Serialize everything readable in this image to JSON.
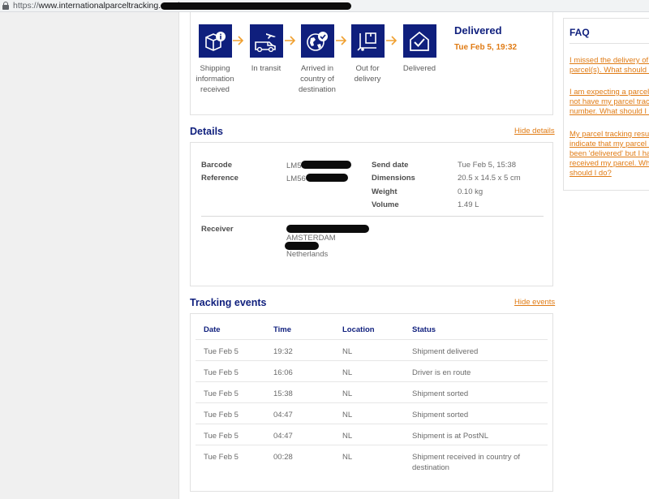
{
  "browser": {
    "url_scheme": "https://",
    "url_host": "www.internationalparceltracking.com/"
  },
  "status": {
    "steps": [
      {
        "label": "Shipping\ninformation\nreceived",
        "icon": "parcel-info-icon"
      },
      {
        "label": "In transit",
        "icon": "plane-van-icon"
      },
      {
        "label": "Arrived in\ncountry of\ndestination",
        "icon": "globe-check-icon"
      },
      {
        "label": "Out for\ndelivery",
        "icon": "box-dolly-icon"
      },
      {
        "label": "Delivered",
        "icon": "house-check-icon"
      }
    ],
    "title": "Delivered",
    "time": "Tue Feb 5, 19:32"
  },
  "details": {
    "title": "Details",
    "toggle": "Hide details",
    "barcode_label": "Barcode",
    "barcode_value": "LM5",
    "reference_label": "Reference",
    "reference_value": "LM56",
    "send_date_label": "Send date",
    "send_date_value": "Tue Feb 5, 15:38",
    "dimensions_label": "Dimensions",
    "dimensions_value": "20.5 x 14.5 x 5 cm",
    "weight_label": "Weight",
    "weight_value": "0.10 kg",
    "volume_label": "Volume",
    "volume_value": "1.49 L",
    "receiver_label": "Receiver",
    "receiver_city": "AMSTERDAM",
    "receiver_country": "Netherlands"
  },
  "events": {
    "title": "Tracking events",
    "toggle": "Hide events",
    "headers": {
      "date": "Date",
      "time": "Time",
      "location": "Location",
      "status": "Status"
    },
    "rows": [
      {
        "date": "Tue Feb 5",
        "time": "19:32",
        "location": "NL",
        "status": "Shipment delivered"
      },
      {
        "date": "Tue Feb 5",
        "time": "16:06",
        "location": "NL",
        "status": "Driver is en route"
      },
      {
        "date": "Tue Feb 5",
        "time": "15:38",
        "location": "NL",
        "status": "Shipment sorted"
      },
      {
        "date": "Tue Feb 5",
        "time": "04:47",
        "location": "NL",
        "status": "Shipment sorted"
      },
      {
        "date": "Tue Feb 5",
        "time": "04:47",
        "location": "NL",
        "status": "Shipment is at PostNL"
      },
      {
        "date": "Tue Feb 5",
        "time": "00:28",
        "location": "NL",
        "status": "Shipment received in country of\ndestination"
      }
    ]
  },
  "faq": {
    "title": "FAQ",
    "questions": [
      "I missed the delivery of m\nparcel(s). What should I d",
      "I am expecting a parcel b\nnot have my parcel tracki\nnumber. What should I do",
      "My parcel tracking results\nindicate that my parcel ha\nbeen 'delivered' but I hav\nreceived my parcel. What\nshould I do?"
    ]
  },
  "colors": {
    "brand_navy": "#0f1f7d",
    "accent_orange": "#e07b14"
  }
}
